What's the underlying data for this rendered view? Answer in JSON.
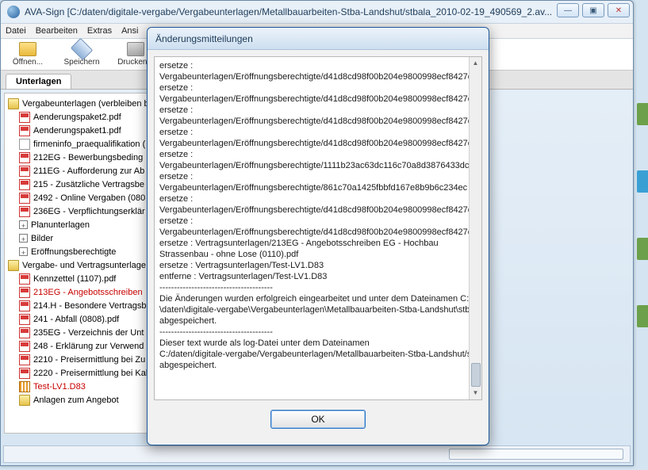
{
  "window": {
    "title": "AVA-Sign [C:/daten/digitale-vergabe/Vergabeunterlagen/Metallbauarbeiten-Stba-Landshut/stbala_2010-02-19_490569_2.av..."
  },
  "window_controls": {
    "min": "—",
    "max": "▣",
    "close": "✕"
  },
  "menu": {
    "items": [
      "Datei",
      "Bearbeiten",
      "Extras",
      "Ansi"
    ]
  },
  "toolbar": {
    "open": "Öffnen...",
    "save": "Speichern",
    "print": "Drucken..."
  },
  "tabs": {
    "active": "Unterlagen"
  },
  "tree": {
    "rows": [
      {
        "icon": "folder",
        "indent": 0,
        "label": "Vergabeunterlagen (verbleiben be",
        "red": false
      },
      {
        "icon": "pdf",
        "indent": 1,
        "label": "Aenderungspaket2.pdf",
        "red": false
      },
      {
        "icon": "pdf",
        "indent": 1,
        "label": "Aenderungspaket1.pdf",
        "red": false
      },
      {
        "icon": "txt",
        "indent": 1,
        "label": "firmeninfo_praequalifikation (",
        "red": false
      },
      {
        "icon": "pdf",
        "indent": 1,
        "label": "212EG - Bewerbungsbeding",
        "red": false
      },
      {
        "icon": "pdf",
        "indent": 1,
        "label": "211EG - Aufforderung zur Ab",
        "red": false
      },
      {
        "icon": "pdf",
        "indent": 1,
        "label": "215 - Zusätzliche Vertragsbe",
        "red": false
      },
      {
        "icon": "pdf",
        "indent": 1,
        "label": "2492 - Online Vergaben (080",
        "red": false
      },
      {
        "icon": "pdf",
        "indent": 1,
        "label": "236EG - Verpflichtungserklär",
        "red": false
      },
      {
        "icon": "plus",
        "indent": 1,
        "label": "Planunterlagen",
        "red": false
      },
      {
        "icon": "plus",
        "indent": 1,
        "label": "Bilder",
        "red": false
      },
      {
        "icon": "plus",
        "indent": 1,
        "label": "Eröffnungsberechtigte",
        "red": false
      },
      {
        "icon": "folder",
        "indent": 0,
        "label": "Vergabe- und Vertragsunterlage",
        "red": false
      },
      {
        "icon": "pdf",
        "indent": 1,
        "label": "Kennzettel (1107).pdf",
        "red": false
      },
      {
        "icon": "pdf",
        "indent": 1,
        "label": "213EG - Angebotsschreiben",
        "red": true
      },
      {
        "icon": "pdf",
        "indent": 1,
        "label": "214.H - Besondere Vertragsb",
        "red": false
      },
      {
        "icon": "pdf",
        "indent": 1,
        "label": "241 - Abfall (0808).pdf",
        "red": false
      },
      {
        "icon": "pdf",
        "indent": 1,
        "label": "235EG - Verzeichnis der Unt",
        "red": false
      },
      {
        "icon": "pdf",
        "indent": 1,
        "label": "248 - Erklärung zur Verwend",
        "red": false
      },
      {
        "icon": "pdf",
        "indent": 1,
        "label": "2210 - Preisermittlung bei Zu",
        "red": false
      },
      {
        "icon": "pdf",
        "indent": 1,
        "label": "2220 - Preisermittlung bei Kal",
        "red": false
      },
      {
        "icon": "special",
        "indent": 1,
        "label": "Test-LV1.D83",
        "red": true
      },
      {
        "icon": "folder",
        "indent": 1,
        "label": "Anlagen zum Angebot",
        "red": false
      }
    ]
  },
  "dialog": {
    "title": "Änderungsmitteilungen",
    "lines": [
      "ersetze   :",
      "Vergabeunterlagen/Eröffnungsberechtigte/d41d8cd98f00b204e9800998ecf8427e",
      "ersetze   :",
      "Vergabeunterlagen/Eröffnungsberechtigte/d41d8cd98f00b204e9800998ecf8427e",
      "ersetze   :",
      "Vergabeunterlagen/Eröffnungsberechtigte/d41d8cd98f00b204e9800998ecf8427e",
      "ersetze   :",
      "Vergabeunterlagen/Eröffnungsberechtigte/d41d8cd98f00b204e9800998ecf8427e",
      "ersetze   :",
      "Vergabeunterlagen/Eröffnungsberechtigte/1111b23ac63dc116c70a8d3876433dc",
      "ersetze   :",
      "Vergabeunterlagen/Eröffnungsberechtigte/861c70a1425fbbfd167e8b9b6c234ec",
      "ersetze   :",
      "Vergabeunterlagen/Eröffnungsberechtigte/d41d8cd98f00b204e9800998ecf8427e",
      "ersetze   :",
      "Vergabeunterlagen/Eröffnungsberechtigte/d41d8cd98f00b204e9800998ecf8427e",
      "ersetze   : Vertragsunterlagen/213EG - Angebotsschreiben EG - Hochbau",
      "Strassenbau - ohne Lose (0110).pdf",
      "ersetze   : Vertragsunterlagen/Test-LV1.D83",
      "entferne : Vertragsunterlagen/Test-LV1.D83",
      "---------------------------------------",
      "Die Änderungen wurden erfolgreich eingearbeitet und unter dem Dateinamen C:",
      "\\daten\\digitale-vergabe\\Vergabeunterlagen\\Metallbauarbeiten-Stba-Landshut\\stb",
      "abgespeichert.",
      "---------------------------------------",
      "Dieser text wurde als log-Datei unter dem Dateinamen",
      "C:/daten/digitale-vergabe/Vergabeunterlagen/Metallbauarbeiten-Stba-Landshut/s",
      "abgespeichert."
    ],
    "ok": "OK"
  }
}
